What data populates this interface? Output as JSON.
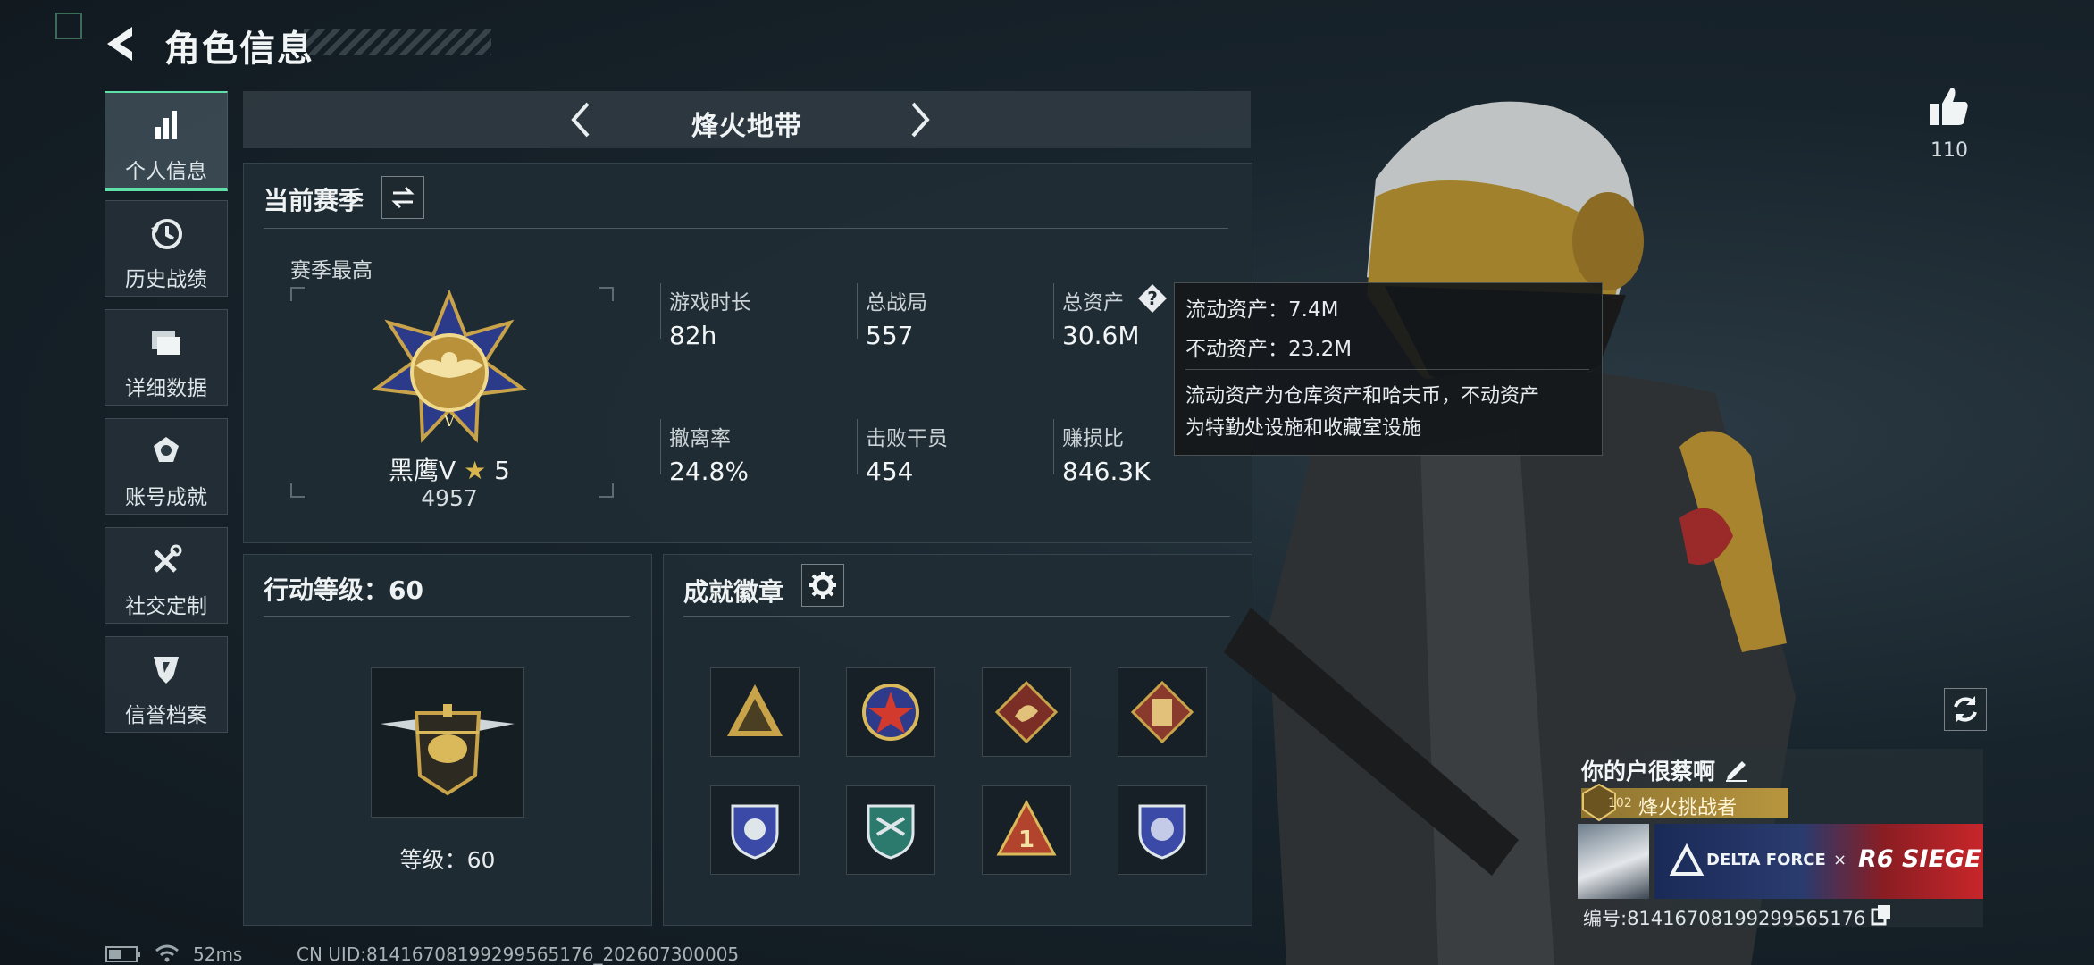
{
  "header": {
    "title": "角色信息"
  },
  "sidebar": {
    "items": [
      {
        "label": "个人信息",
        "icon": "bar-chart-icon",
        "active": true
      },
      {
        "label": "历史战绩",
        "icon": "history-clock-icon"
      },
      {
        "label": "详细数据",
        "icon": "folders-icon"
      },
      {
        "label": "账号成就",
        "icon": "achievement-medal-icon"
      },
      {
        "label": "社交定制",
        "icon": "wrench-screwdriver-icon"
      },
      {
        "label": "信誉档案",
        "icon": "reputation-shield-icon"
      }
    ]
  },
  "mode": {
    "title": "烽火地带"
  },
  "season": {
    "title": "当前赛季",
    "best_label": "赛季最高",
    "rank_name": "黑鹰Ⅴ",
    "rank_stars": "5",
    "rank_points": "4957",
    "stats": [
      {
        "label": "游戏时长",
        "value": "82h"
      },
      {
        "label": "总战局",
        "value": "557"
      },
      {
        "label": "总资产",
        "value": "30.6M"
      },
      {
        "label": "撤离率",
        "value": "24.8%"
      },
      {
        "label": "击败干员",
        "value": "454"
      },
      {
        "label": "赚损比",
        "value": "846.3K"
      }
    ]
  },
  "tooltip": {
    "liquid": "流动资产：7.4M",
    "fixed": "不动资产：23.2M",
    "desc_line1": "流动资产为仓库资产和哈夫币，不动资产",
    "desc_line2": "为特勤处设施和收藏室设施"
  },
  "action_level": {
    "title": "行动等级：60",
    "level_text": "等级：60"
  },
  "badges": {
    "title": "成就徽章",
    "items": [
      "triangle-soldiers-badge",
      "star-shield-badge",
      "dragon-diamond-badge",
      "vest-diamond-badge",
      "blue-shield-badge",
      "arrows-shield-badge",
      "number-one-triangle-badge",
      "lion-shield-badge"
    ]
  },
  "like": {
    "count": "110"
  },
  "player": {
    "name": "你的户很蔡啊",
    "title_badge": "烽火挑战者",
    "title_level": "102",
    "banner_brand": "DELTA FORCE",
    "banner_x": "×",
    "banner_collab": "R6 SIEGE",
    "id_text": "编号:8141670819929956517­6"
  },
  "status": {
    "ping": "52ms",
    "uid": "CN UID:81416708199299565176_202607300005"
  },
  "colors": {
    "accent_green": "#5fe0a8",
    "gold": "#c9a349"
  }
}
